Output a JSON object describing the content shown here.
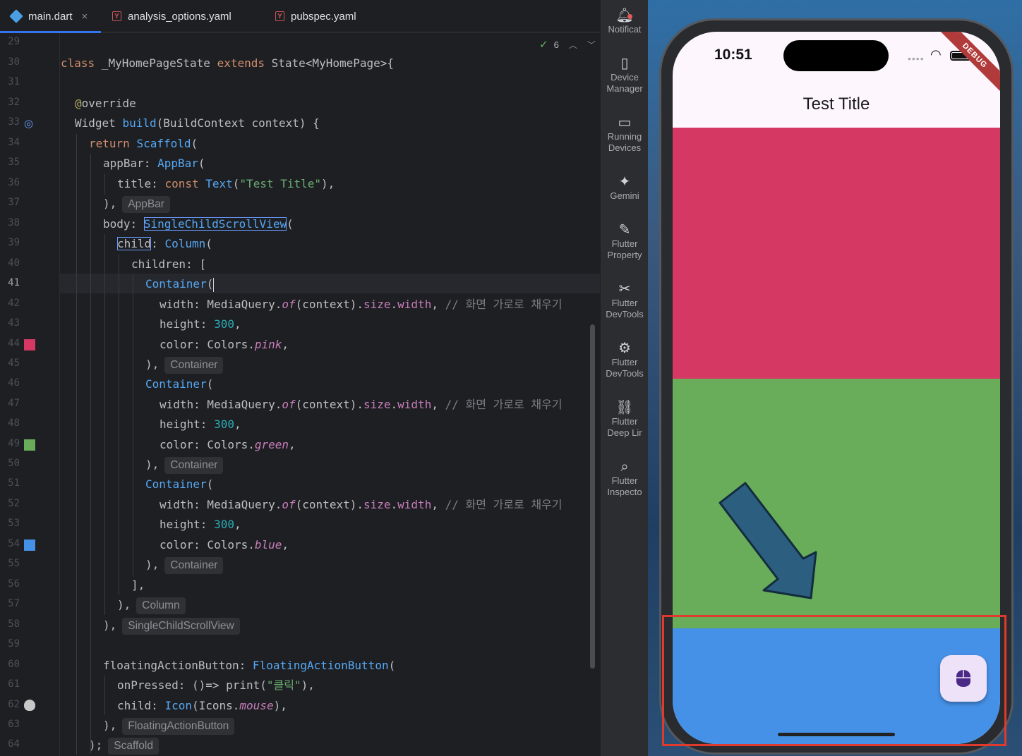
{
  "tabs": [
    {
      "label": "main.dart",
      "active": true
    },
    {
      "label": "analysis_options.yaml"
    },
    {
      "label": "pubspec.yaml"
    }
  ],
  "inspection": {
    "count": "6"
  },
  "line_numbers": [
    "29",
    "30",
    "31",
    "32",
    "33",
    "34",
    "35",
    "36",
    "37",
    "38",
    "39",
    "40",
    "41",
    "42",
    "43",
    "44",
    "45",
    "46",
    "47",
    "48",
    "49",
    "50",
    "51",
    "52",
    "53",
    "54",
    "55",
    "56",
    "57",
    "58",
    "59",
    "60",
    "61",
    "62",
    "63",
    "64"
  ],
  "current_line": "41",
  "code": {
    "l30": [
      "class",
      " _MyHomePageState ",
      "extends",
      " State<MyHomePage>{"
    ],
    "l32": [
      "@",
      "override"
    ],
    "l33": [
      "Widget ",
      "build",
      "(BuildContext context) {"
    ],
    "l34": [
      "return",
      " ",
      "Scaffold",
      "("
    ],
    "l35": [
      "appBar: ",
      "AppBar",
      "("
    ],
    "l36": [
      "title: ",
      "const",
      " ",
      "Text",
      "(",
      "\"Test Title\"",
      "),"
    ],
    "l37": [
      "),",
      "AppBar"
    ],
    "l38": [
      "body: ",
      "SingleChildScrollView",
      "("
    ],
    "l39": [
      "child",
      ": ",
      "Column",
      "("
    ],
    "l40": [
      "children: ["
    ],
    "l41": [
      "Container",
      "("
    ],
    "width_line": [
      "width: MediaQuery.",
      "of",
      "(context).",
      "size",
      ".",
      "width",
      ", ",
      "// 화면 가로로 채우기"
    ],
    "height_key": "height: ",
    "height_val": "300",
    "color_key": "color: Colors.",
    "colors": [
      "pink",
      "green",
      "blue"
    ],
    "container_hint": "Container",
    "l56": "],",
    "l57": [
      "),",
      "Column"
    ],
    "l58": [
      "),",
      "SingleChildScrollView"
    ],
    "l60": [
      "floatingActionButton: ",
      "FloatingActionButton",
      "("
    ],
    "l61": [
      "onPressed: ()=> print(",
      "\"클릭\"",
      "),"
    ],
    "l62": [
      "child: ",
      "Icon",
      "(Icons.",
      "mouse",
      "),"
    ],
    "l63": [
      "),",
      "FloatingActionButton"
    ],
    "l64": [
      ");",
      "Scaffold"
    ]
  },
  "gutter_colors": {
    "pink": "#d63864",
    "green": "#69ad5a",
    "blue": "#4691e8"
  },
  "tools": [
    {
      "icon": "bell-icon",
      "label": "Notificat"
    },
    {
      "icon": "device-manager-icon",
      "label": "Device Manager"
    },
    {
      "icon": "running-devices-icon",
      "label": "Running Devices"
    },
    {
      "icon": "gemini-icon",
      "label": "Gemini"
    },
    {
      "icon": "pencil-icon",
      "label": "Flutter Property"
    },
    {
      "icon": "devtools-icon",
      "label": "Flutter DevTools"
    },
    {
      "icon": "devtools-2-icon",
      "label": "Flutter DevTools"
    },
    {
      "icon": "link-icon",
      "label": "Flutter Deep Lir"
    },
    {
      "icon": "inspector-icon",
      "label": "Flutter Inspecto"
    }
  ],
  "device": {
    "time": "10:51",
    "debug_banner": "DEBUG",
    "app_title": "Test Title",
    "fab_icon": "mouse-icon",
    "box_colors": [
      "#d63864",
      "#69ad5a",
      "#4691e8"
    ]
  },
  "annotation": {
    "arrow_color": "#2b5e7f",
    "highlight_color": "#e0392d"
  }
}
